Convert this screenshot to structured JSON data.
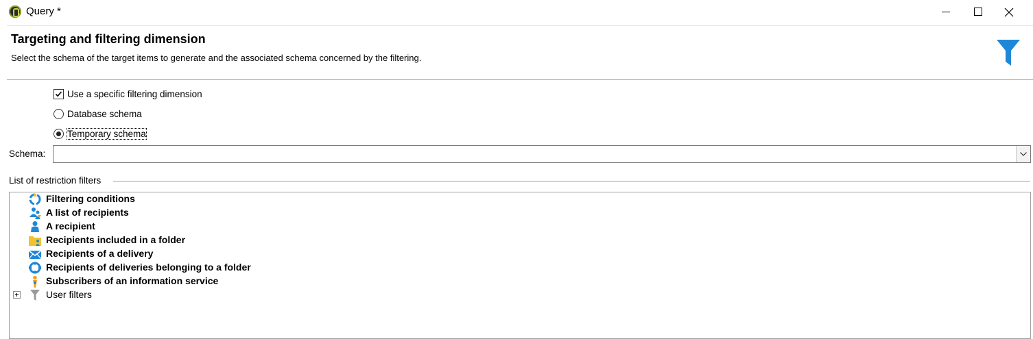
{
  "window": {
    "title": "Query *"
  },
  "header": {
    "title": "Targeting and filtering dimension",
    "description": "Select the schema of the target items to  generate and the associated schema concerned by the filtering."
  },
  "options": {
    "use_specific_filtering": {
      "label": "Use a specific filtering dimension",
      "checked": true
    },
    "database_schema": {
      "label": "Database schema",
      "selected": false
    },
    "temporary_schema": {
      "label": "Temporary schema",
      "selected": true
    }
  },
  "schema": {
    "label": "Schema:",
    "value": ""
  },
  "restriction_filters": {
    "label": "List of restriction filters",
    "items": [
      {
        "label": "Filtering conditions",
        "icon": "filtering-conditions-icon"
      },
      {
        "label": "A list of recipients",
        "icon": "recipient-list-icon"
      },
      {
        "label": "A recipient",
        "icon": "recipient-icon"
      },
      {
        "label": "Recipients included in a folder",
        "icon": "folder-recipients-icon"
      },
      {
        "label": "Recipients of a delivery",
        "icon": "delivery-envelope-icon"
      },
      {
        "label": "Recipients of deliveries belonging to a folder",
        "icon": "delivery-folder-icon"
      },
      {
        "label": "Subscribers of an information service",
        "icon": "subscriber-icon"
      },
      {
        "label": "User filters",
        "icon": "user-filters-funnel-icon"
      }
    ]
  },
  "colors": {
    "accent_blue": "#1e88d8",
    "folder_yellow": "#f2c22e",
    "subscriber_orange": "#f0a020"
  }
}
